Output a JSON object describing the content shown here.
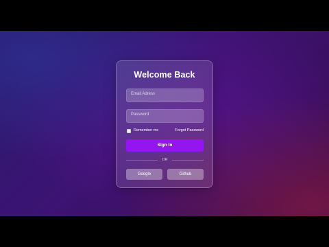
{
  "login": {
    "title": "Welcome Back",
    "email_placeholder": "Email Adress",
    "password_placeholder": "Password",
    "remember_label": "Remember me",
    "remember_checked": false,
    "forgot_label": "Forgot Password",
    "signin_label": "Sign In",
    "divider_text": "OR",
    "social": {
      "google_label": "Google",
      "github_label": "Github"
    }
  },
  "colors": {
    "accent": "#9315f0",
    "background_dark": "#2a1a6e",
    "background_warm": "#3a0d3e"
  }
}
